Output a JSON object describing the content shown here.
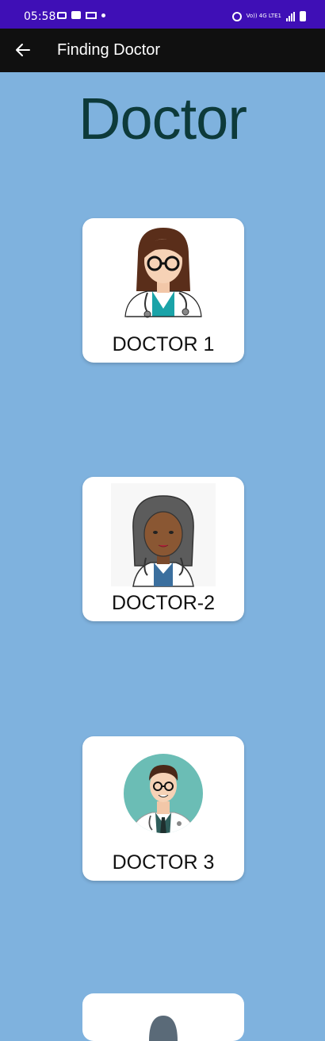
{
  "status_bar": {
    "time": "05:58",
    "network_label": "Vo)) 4G LTE1"
  },
  "app_bar": {
    "title": "Finding Doctor",
    "back_icon": "back-arrow-icon"
  },
  "page": {
    "heading": "Doctor"
  },
  "doctors": [
    {
      "label": "DOCTOR 1",
      "avatar": "female-doctor-glasses-icon"
    },
    {
      "label": "DOCTOR-2",
      "avatar": "female-doctor-dark-hair-icon"
    },
    {
      "label": "DOCTOR 3",
      "avatar": "male-doctor-circle-icon"
    },
    {
      "label": "",
      "avatar": "doctor-avatar-icon"
    }
  ],
  "colors": {
    "status_bar": "#3f0fb6",
    "app_bar": "#101010",
    "background": "#7fb2de",
    "heading": "#0d3a3a",
    "card": "#ffffff"
  }
}
